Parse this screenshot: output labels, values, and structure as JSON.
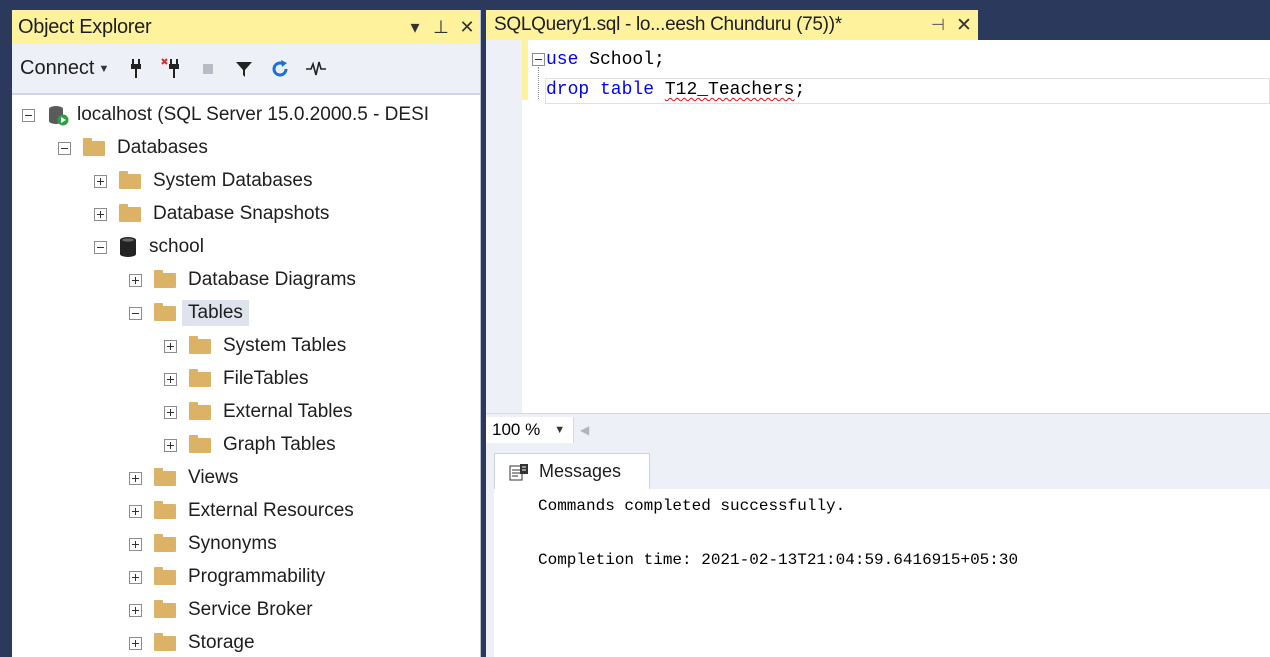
{
  "object_explorer": {
    "title": "Object Explorer",
    "title_buttons": [
      "▾",
      "⊥",
      "✕"
    ],
    "connect_label": "Connect",
    "tree": [
      {
        "label": "localhost (SQL Server 15.0.2000.5 - DESI",
        "icon": "server-icon",
        "expander": "minus"
      },
      {
        "label": "Databases",
        "icon": "folder-icon",
        "expander": "minus"
      },
      {
        "label": "System Databases",
        "icon": "folder-icon",
        "expander": "plus"
      },
      {
        "label": "Database Snapshots",
        "icon": "folder-icon",
        "expander": "plus"
      },
      {
        "label": "school",
        "icon": "database-icon",
        "expander": "minus"
      },
      {
        "label": "Database Diagrams",
        "icon": "folder-icon",
        "expander": "plus"
      },
      {
        "label": "Tables",
        "icon": "folder-icon",
        "expander": "minus",
        "selected": true
      },
      {
        "label": "System Tables",
        "icon": "folder-icon",
        "expander": "plus"
      },
      {
        "label": "FileTables",
        "icon": "folder-icon",
        "expander": "plus"
      },
      {
        "label": "External Tables",
        "icon": "folder-icon",
        "expander": "plus"
      },
      {
        "label": "Graph Tables",
        "icon": "folder-icon",
        "expander": "plus"
      },
      {
        "label": "Views",
        "icon": "folder-icon",
        "expander": "plus"
      },
      {
        "label": "External Resources",
        "icon": "folder-icon",
        "expander": "plus"
      },
      {
        "label": "Synonyms",
        "icon": "folder-icon",
        "expander": "plus"
      },
      {
        "label": "Programmability",
        "icon": "folder-icon",
        "expander": "plus"
      },
      {
        "label": "Service Broker",
        "icon": "folder-icon",
        "expander": "plus"
      },
      {
        "label": "Storage",
        "icon": "folder-icon",
        "expander": "plus"
      }
    ]
  },
  "editor": {
    "tab_title": "SQLQuery1.sql - lo...eesh Chunduru (75))*",
    "tab_pin": "⊣",
    "tab_close": "✕",
    "lines": [
      {
        "keyword": "use",
        "rest": " School;"
      },
      {
        "keyword": "drop table",
        "rest_pre": " ",
        "squiggle": "T12_Teachers",
        "rest_post": ";"
      }
    ],
    "zoom": "100 %"
  },
  "results": {
    "tab_label": "Messages",
    "messages": [
      "Commands completed successfully.",
      "Completion time: 2021-02-13T21:04:59.6416915+05:30"
    ]
  },
  "colors": {
    "chrome": "#2b3a5c",
    "active_tab": "#fff29d",
    "keyword": "#0000ff",
    "folder": "#dcb267"
  }
}
